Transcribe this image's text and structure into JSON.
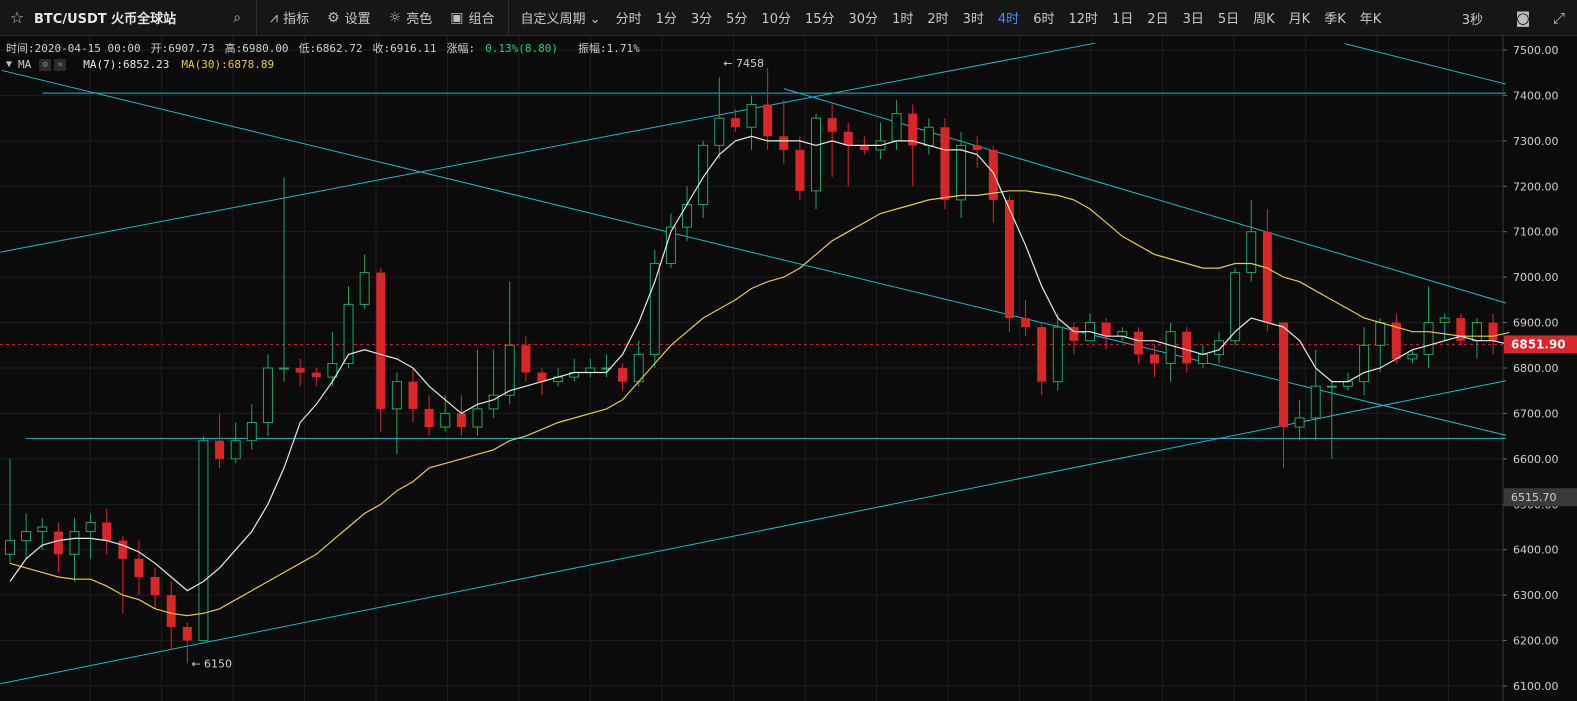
{
  "toolbar": {
    "symbol": "BTC/USDT 火币全球站",
    "tools": [
      {
        "icon": "line-chart-icon",
        "label": "指标"
      },
      {
        "icon": "gear-icon",
        "label": "设置"
      },
      {
        "icon": "sun-icon",
        "label": "亮色"
      },
      {
        "icon": "grid-icon",
        "label": "组合"
      }
    ],
    "custom_period": "自定义周期",
    "periods": [
      "分时",
      "1分",
      "3分",
      "5分",
      "10分",
      "15分",
      "30分",
      "1时",
      "2时",
      "3时",
      "4时",
      "6时",
      "12时",
      "1日",
      "2日",
      "3日",
      "5日",
      "周K",
      "月K",
      "季K",
      "年K"
    ],
    "active_period": "4时",
    "refresh": "3秒"
  },
  "info": {
    "time": "时间:2020-04-15 00:00",
    "open": "开:6907.73",
    "high": "高:6980.00",
    "low": "低:6862.72",
    "close": "收:6916.11",
    "change_label": "涨幅:",
    "change_value": "0.13%(8.80)",
    "amplitude": "振幅:1.71%"
  },
  "ma_legend": {
    "label": "MA",
    "ma7": "MA(7):6852.23",
    "ma30": "MA(30):6878.89"
  },
  "colors": {
    "up": "#1fa55a",
    "down": "#d9262a",
    "ma7": "#e8e8e8",
    "ma30": "#e6c84a",
    "trendline": "#1fb8c4",
    "active": "#3f8cff"
  },
  "chart_data": {
    "type": "candlestick",
    "ylim": [
      6100,
      7520
    ],
    "ticks": [
      7500,
      7400,
      7300,
      7200,
      7100,
      7000,
      6900,
      6800,
      6700,
      6600,
      6500,
      6400,
      6300,
      6200,
      6100
    ],
    "tick_labels": [
      "7500.00",
      "7400.00",
      "7300.00",
      "7200.00",
      "7100.00",
      "7000.00",
      "6900.00",
      "6800.00",
      "6700.00",
      "6600.00",
      "6500.00",
      "6400.00",
      "6300.00",
      "6200.00",
      "6100.00"
    ],
    "current_price": 6851.9,
    "current_price_label": "6851.90",
    "cursor_price": 6515.7,
    "cursor_price_label": "6515.70",
    "annotations": [
      {
        "text": "← 7458",
        "value": 7458,
        "index": 44
      },
      {
        "text": "← 6150",
        "value": 6150,
        "index": 11
      }
    ],
    "candles": [
      [
        6390,
        6420,
        6370,
        6600
      ],
      [
        6420,
        6440,
        6380,
        6480
      ],
      [
        6440,
        6450,
        6400,
        6470
      ],
      [
        6440,
        6390,
        6350,
        6460
      ],
      [
        6390,
        6440,
        6330,
        6470
      ],
      [
        6440,
        6460,
        6380,
        6480
      ],
      [
        6460,
        6420,
        6390,
        6490
      ],
      [
        6420,
        6380,
        6260,
        6430
      ],
      [
        6380,
        6340,
        6300,
        6420
      ],
      [
        6340,
        6300,
        6270,
        6360
      ],
      [
        6300,
        6230,
        6180,
        6330
      ],
      [
        6230,
        6200,
        6150,
        6240
      ],
      [
        6200,
        6640,
        6200,
        6650
      ],
      [
        6640,
        6600,
        6580,
        6700
      ],
      [
        6600,
        6640,
        6590,
        6680
      ],
      [
        6640,
        6680,
        6620,
        6720
      ],
      [
        6680,
        6800,
        6650,
        6830
      ],
      [
        6800,
        6800,
        6770,
        7220
      ],
      [
        6800,
        6790,
        6760,
        6820
      ],
      [
        6790,
        6780,
        6760,
        6800
      ],
      [
        6780,
        6810,
        6760,
        6880
      ],
      [
        6810,
        6940,
        6800,
        6980
      ],
      [
        6940,
        7010,
        6930,
        7050
      ],
      [
        7010,
        6710,
        6660,
        7020
      ],
      [
        6710,
        6770,
        6610,
        6790
      ],
      [
        6770,
        6710,
        6680,
        6800
      ],
      [
        6710,
        6670,
        6650,
        6740
      ],
      [
        6670,
        6700,
        6660,
        6740
      ],
      [
        6700,
        6670,
        6650,
        6740
      ],
      [
        6670,
        6710,
        6650,
        6840
      ],
      [
        6710,
        6740,
        6690,
        6840
      ],
      [
        6740,
        6850,
        6720,
        6990
      ],
      [
        6850,
        6790,
        6770,
        6870
      ],
      [
        6790,
        6770,
        6740,
        6800
      ],
      [
        6770,
        6780,
        6760,
        6800
      ],
      [
        6780,
        6790,
        6770,
        6820
      ],
      [
        6790,
        6800,
        6780,
        6820
      ],
      [
        6800,
        6800,
        6780,
        6830
      ],
      [
        6800,
        6770,
        6750,
        6810
      ],
      [
        6770,
        6830,
        6760,
        6860
      ],
      [
        6830,
        7030,
        6800,
        7060
      ],
      [
        7030,
        7110,
        7020,
        7140
      ],
      [
        7110,
        7160,
        7080,
        7200
      ],
      [
        7160,
        7290,
        7130,
        7300
      ],
      [
        7290,
        7350,
        7260,
        7440
      ],
      [
        7350,
        7330,
        7320,
        7370
      ],
      [
        7330,
        7380,
        7280,
        7400
      ],
      [
        7380,
        7310,
        7280,
        7460
      ],
      [
        7310,
        7280,
        7250,
        7390
      ],
      [
        7280,
        7190,
        7170,
        7310
      ],
      [
        7190,
        7350,
        7150,
        7360
      ],
      [
        7350,
        7320,
        7220,
        7380
      ],
      [
        7320,
        7290,
        7200,
        7340
      ],
      [
        7290,
        7280,
        7270,
        7310
      ],
      [
        7280,
        7300,
        7260,
        7340
      ],
      [
        7300,
        7360,
        7280,
        7390
      ],
      [
        7360,
        7290,
        7200,
        7380
      ],
      [
        7290,
        7330,
        7270,
        7350
      ],
      [
        7330,
        7170,
        7150,
        7350
      ],
      [
        7170,
        7290,
        7130,
        7320
      ],
      [
        7290,
        7280,
        7240,
        7310
      ],
      [
        7280,
        7170,
        7120,
        7290
      ],
      [
        7170,
        6910,
        6880,
        7180
      ],
      [
        6910,
        6890,
        6870,
        6950
      ],
      [
        6890,
        6770,
        6740,
        6900
      ],
      [
        6770,
        6890,
        6750,
        6920
      ],
      [
        6890,
        6860,
        6830,
        6900
      ],
      [
        6860,
        6900,
        6860,
        6920
      ],
      [
        6900,
        6870,
        6840,
        6910
      ],
      [
        6870,
        6880,
        6860,
        6890
      ],
      [
        6880,
        6830,
        6810,
        6890
      ],
      [
        6830,
        6810,
        6780,
        6850
      ],
      [
        6810,
        6880,
        6770,
        6900
      ],
      [
        6880,
        6810,
        6790,
        6890
      ],
      [
        6810,
        6830,
        6800,
        6850
      ],
      [
        6830,
        6860,
        6810,
        6880
      ],
      [
        6860,
        7010,
        6850,
        7020
      ],
      [
        7010,
        7100,
        6990,
        7170
      ],
      [
        7100,
        6900,
        6880,
        7150
      ],
      [
        6900,
        6670,
        6580,
        6900
      ],
      [
        6670,
        6690,
        6640,
        6730
      ],
      [
        6690,
        6760,
        6640,
        6840
      ],
      [
        6760,
        6760,
        6600,
        6770
      ],
      [
        6760,
        6770,
        6750,
        6790
      ],
      [
        6770,
        6850,
        6740,
        6890
      ],
      [
        6850,
        6900,
        6790,
        6910
      ],
      [
        6900,
        6820,
        6810,
        6920
      ],
      [
        6820,
        6830,
        6810,
        6840
      ],
      [
        6830,
        6900,
        6800,
        6980
      ],
      [
        6900,
        6910,
        6860,
        6920
      ],
      [
        6910,
        6860,
        6850,
        6920
      ],
      [
        6860,
        6900,
        6820,
        6910
      ],
      [
        6900,
        6860,
        6830,
        6920
      ],
      [
        6860,
        6852,
        6840,
        6870
      ]
    ],
    "ma7": [
      6330,
      6380,
      6410,
      6420,
      6425,
      6425,
      6420,
      6410,
      6395,
      6370,
      6340,
      6310,
      6330,
      6360,
      6400,
      6440,
      6500,
      6580,
      6680,
      6720,
      6770,
      6830,
      6840,
      6830,
      6820,
      6800,
      6760,
      6730,
      6700,
      6720,
      6730,
      6750,
      6760,
      6770,
      6780,
      6790,
      6790,
      6790,
      6830,
      6900,
      6990,
      7100,
      7160,
      7220,
      7270,
      7300,
      7310,
      7300,
      7300,
      7300,
      7290,
      7300,
      7290,
      7290,
      7290,
      7300,
      7300,
      7290,
      7280,
      7280,
      7270,
      7230,
      7150,
      7070,
      6980,
      6910,
      6880,
      6880,
      6870,
      6870,
      6860,
      6860,
      6850,
      6840,
      6830,
      6840,
      6880,
      6910,
      6900,
      6890,
      6860,
      6800,
      6770,
      6770,
      6790,
      6800,
      6820,
      6840,
      6850,
      6860,
      6870,
      6860,
      6860,
      6852
    ],
    "ma30": [
      6370,
      6360,
      6350,
      6340,
      6335,
      6335,
      6320,
      6300,
      6290,
      6270,
      6260,
      6255,
      6260,
      6270,
      6290,
      6310,
      6330,
      6350,
      6370,
      6390,
      6420,
      6450,
      6480,
      6500,
      6530,
      6550,
      6580,
      6590,
      6600,
      6610,
      6620,
      6640,
      6650,
      6665,
      6680,
      6690,
      6700,
      6710,
      6730,
      6770,
      6810,
      6850,
      6880,
      6910,
      6930,
      6950,
      6975,
      6990,
      7000,
      7020,
      7050,
      7080,
      7100,
      7120,
      7140,
      7150,
      7160,
      7170,
      7175,
      7180,
      7180,
      7185,
      7190,
      7190,
      7185,
      7180,
      7170,
      7150,
      7120,
      7090,
      7070,
      7050,
      7040,
      7030,
      7020,
      7020,
      7030,
      7030,
      7020,
      7000,
      6990,
      6970,
      6950,
      6930,
      6910,
      6900,
      6890,
      6880,
      6880,
      6875,
      6870,
      6870,
      6870,
      6878
    ]
  }
}
